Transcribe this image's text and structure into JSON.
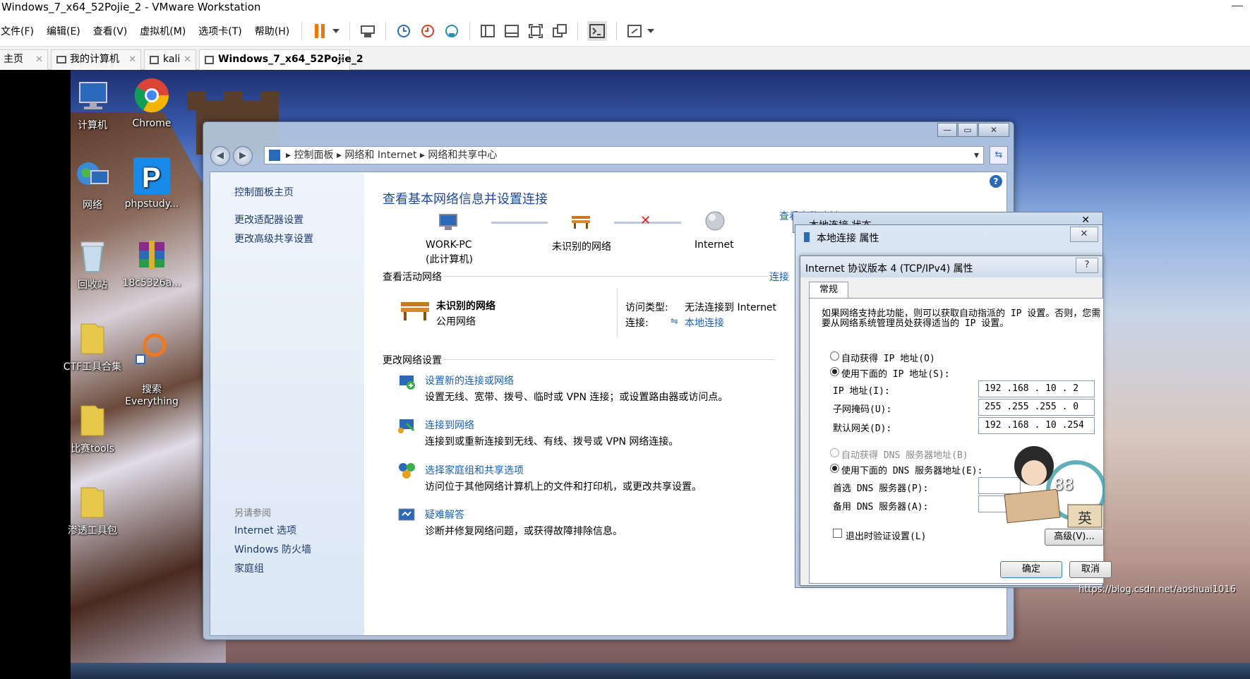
{
  "vm": {
    "title": "Windows_7_x64_52Pojie_2 - VMware Workstation",
    "menu": [
      "文件(F)",
      "编辑(E)",
      "查看(V)",
      "虚拟机(M)",
      "选项卡(T)",
      "帮助(H)"
    ],
    "tabs": [
      {
        "label": "主页"
      },
      {
        "label": "我的计算机"
      },
      {
        "label": "kali"
      },
      {
        "label": "Windows_7_x64_52Pojie_2"
      }
    ]
  },
  "desktop": {
    "icons": [
      {
        "label": "计算机"
      },
      {
        "label": "Chrome"
      },
      {
        "label": "网络"
      },
      {
        "label": "phpstudy..."
      },
      {
        "label": "回收站"
      },
      {
        "label": "18c5326a..."
      },
      {
        "label": "CTF工具合集"
      },
      {
        "label": "搜索\nEverything"
      },
      {
        "label": "比赛tools"
      },
      {
        "label": "渗透工具包"
      }
    ]
  },
  "network_center": {
    "breadcrumb": [
      "控制面板",
      "网络和 Internet",
      "网络和共享中心"
    ],
    "left_links": [
      "控制面板主页",
      "更改适配器设置",
      "更改高级共享设置"
    ],
    "see_also_title": "另请参阅",
    "see_also": [
      "Internet 选项",
      "Windows 防火墙",
      "家庭组"
    ],
    "heading": "查看基本网络信息并设置连接",
    "map": {
      "pc": "WORK-PC",
      "pc_sub": "(此计算机)",
      "network": "未识别的网络",
      "internet": "Internet",
      "full_map_link": "查看完整映射"
    },
    "active_title": "查看活动网络",
    "active_link": "连接",
    "active": {
      "name": "未识别的网络",
      "type": "公用网络",
      "access_label": "访问类型:",
      "access_value": "无法连接到 Internet",
      "conn_label": "连接:",
      "conn_value": "本地连接"
    },
    "change_title": "更改网络设置",
    "tasks": [
      {
        "title": "设置新的连接或网络",
        "desc": "设置无线、宽带、拨号、临时或 VPN 连接；或设置路由器或访问点。"
      },
      {
        "title": "连接到网络",
        "desc": "连接到或重新连接到无线、有线、拨号或 VPN 网络连接。"
      },
      {
        "title": "选择家庭组和共享选项",
        "desc": "访问位于其他网络计算机上的文件和打印机，或更改共享设置。"
      },
      {
        "title": "疑难解答",
        "desc": "诊断并修复网络问题，或获得故障排除信息。"
      }
    ]
  },
  "status_dialog": {
    "title": "本地连接 状态"
  },
  "props_dialog": {
    "title": "本地连接 属性"
  },
  "ipv4": {
    "title": "Internet 协议版本 4 (TCP/IPv4) 属性",
    "tab": "常规",
    "intro1": "如果网络支持此功能，则可以获取自动指派的 IP 设置。否则，您需",
    "intro2": "要从网络系统管理员处获得适当的 IP 设置。",
    "auto_ip": "自动获得 IP 地址(O)",
    "manual_ip": "使用下面的 IP 地址(S):",
    "ip_label": "IP 地址(I):",
    "ip_value": "192 .168 . 10  . 2",
    "mask_label": "子网掩码(U):",
    "mask_value": "255 .255 .255  . 0",
    "gw_label": "默认网关(D):",
    "gw_value": "192 .168 . 10  .254",
    "auto_dns": "自动获得 DNS 服务器地址(B)",
    "manual_dns": "使用下面的 DNS 服务器地址(E):",
    "dns1_label": "首选 DNS 服务器(P):",
    "dns2_label": "备用 DNS 服务器(A):",
    "validate": "退出时验证设置(L)",
    "advanced": "高级(V)...",
    "ok": "确定",
    "cancel": "取消"
  },
  "overlay": {
    "gauge": "88",
    "ime": "英"
  },
  "watermark": "https://blog.csdn.net/aoshuai1016"
}
